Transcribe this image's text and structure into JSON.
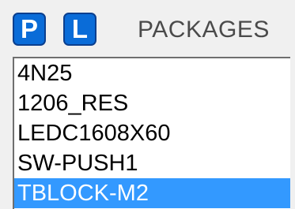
{
  "header": {
    "p_button_label": "P",
    "l_button_label": "L",
    "title": "PACKAGES"
  },
  "packages": {
    "items": [
      {
        "label": "4N25",
        "selected": false
      },
      {
        "label": "1206_RES",
        "selected": false
      },
      {
        "label": "LEDC1608X60",
        "selected": false
      },
      {
        "label": "SW-PUSH1",
        "selected": false
      },
      {
        "label": "TBLOCK-M2",
        "selected": true
      }
    ]
  },
  "colors": {
    "button_blue": "#0a6cd8",
    "selection_blue": "#3399ff",
    "panel_gray": "#f0f0f0"
  }
}
